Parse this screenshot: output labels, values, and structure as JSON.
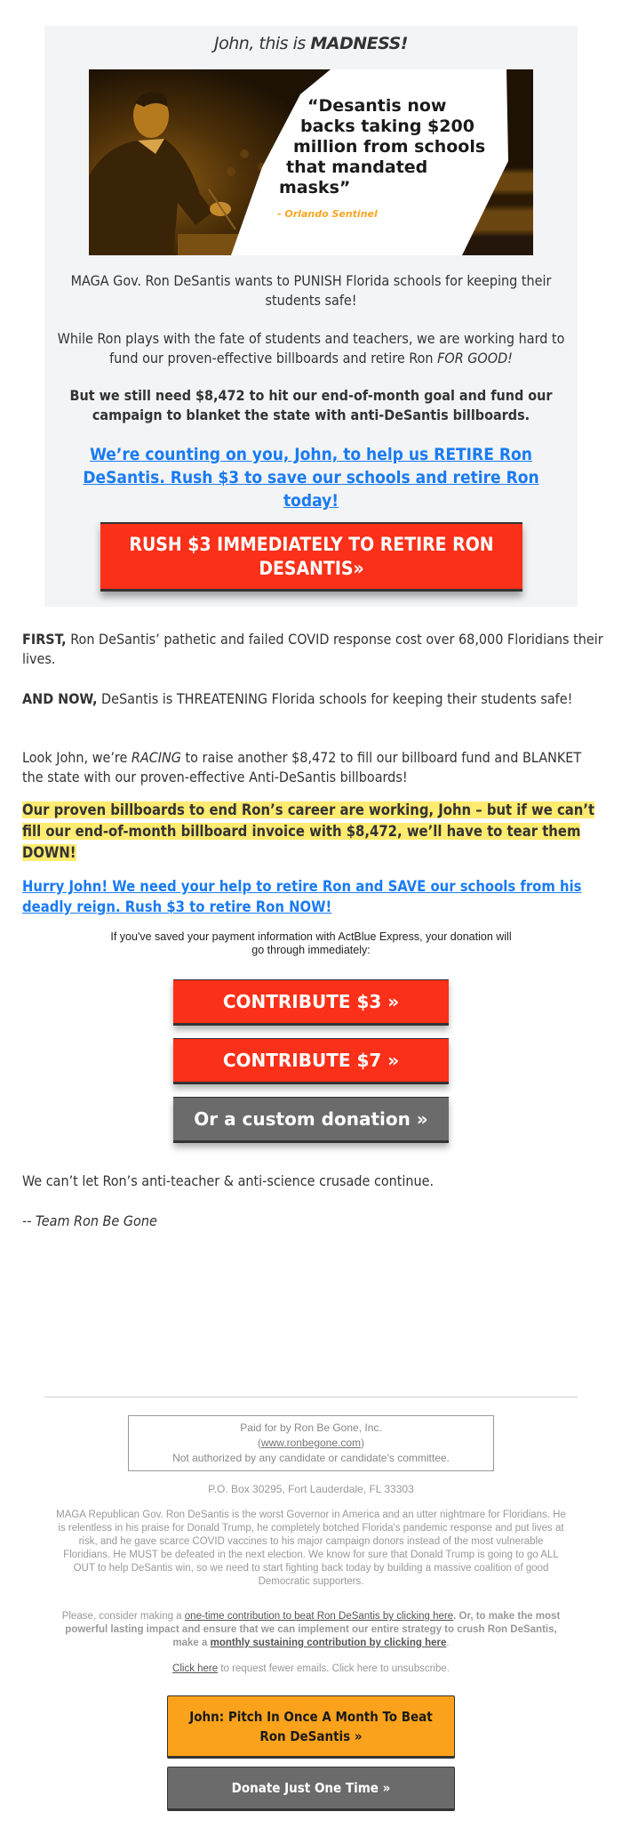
{
  "hero": {
    "title_prefix": "John, this is ",
    "title_emphasis": "MADNESS!",
    "image": {
      "quote_lines": [
        "“Desantis now",
        "backs taking $200",
        "million from schools",
        "that mandated",
        "masks”"
      ],
      "source": "- Orlando Sentinel"
    },
    "paragraph_1": "MAGA Gov. Ron DeSantis wants to PUNISH Florida schools for keeping their students safe!",
    "paragraph_2_main": "While Ron plays with the fate of students and teachers, we are working hard to fund our proven-effective billboards and retire Ron ",
    "paragraph_2_emphasis": "FOR GOOD!",
    "paragraph_3": "But we still need $8,472 to hit our end-of-month goal and fund our campaign to blanket the state with anti-DeSantis billboards.",
    "link_text": "We’re counting on you, John, to help us RETIRE Ron DeSantis. Rush $3 to save our schools and retire Ron today!",
    "button_label": "RUSH $3 IMMEDIATELY TO RETIRE RON DESANTIS»"
  },
  "body": {
    "first_lead": "FIRST,",
    "first_text": " Ron DeSantis’ pathetic and failed COVID response cost over 68,000 Floridians their lives.",
    "now_lead": "AND NOW,",
    "now_text": " DeSantis is THREATENING Florida schools for keeping their students safe!",
    "racing_prefix": "Look John, we’re ",
    "racing_emphasis": "RACING",
    "racing_suffix": " to raise another $8,472 to fill our billboard fund and BLANKET the state with our proven-effective Anti-DeSantis billboards!",
    "highlight_text": "Our proven billboards to end Ron’s career are working, John – but if we can’t fill our end-of-month billboard invoice with $8,472, we’ll have to tear them DOWN!",
    "hurry_link": "Hurry John! We need your help to retire Ron and SAVE our schools from his deadly reign. Rush $3 to retire Ron NOW!",
    "actblue_note": "If you've saved your payment information with ActBlue Express, your donation will go through immediately:",
    "donate_buttons": [
      {
        "label": "CONTRIBUTE $3 »",
        "color": "#fa3019"
      },
      {
        "label": "CONTRIBUTE $7 »",
        "color": "#fa3019"
      },
      {
        "label": "Or a custom donation »",
        "color": "#6b6b6b"
      }
    ],
    "closing": "We can’t let Ron’s anti-teacher & anti-science crusade continue.",
    "signature": "-- Team Ron Be Gone"
  },
  "footer": {
    "paid_for": "Paid for by Ron Be Gone, Inc.",
    "website_open": "(",
    "website": "www.ronbegone.com",
    "website_close": ")",
    "disclaimer": "Not authorized by any candidate or candidate's committee.",
    "address": "P.O. Box 30295, Fort Lauderdale, FL 33303",
    "about": "MAGA Republican Gov. Ron DeSantis is the worst Governor in America and an utter nightmare for Floridians. He is relentless in his praise for Donald Trump, he completely botched Florida's pandemic response and put lives at risk, and he gave scarce COVID vaccines to his major campaign donors instead of the most vulnerable Floridians. He MUST be defeated in the next election. We know for sure that Donald Trump is going to go ALL OUT to help DeSantis win, so we need to start fighting back today by building a massive coalition of good Democratic supporters.",
    "cta_prefix": "Please, consider making a ",
    "cta_onetime_link": "one-time contribution to beat Ron DeSantis by clicking here",
    "cta_middle": ". Or, to make the most powerful lasting impact and ensure that we can implement our entire strategy to crush Ron DeSantis, make a ",
    "cta_monthly_link": "monthly sustaining contribution by clicking here",
    "cta_end": ".",
    "unsub_link": "Click here",
    "unsub_text": " to request fewer emails. Click here to unsubscribe.",
    "monthly_button": "John: Pitch In Once A Month To Beat Ron DeSantis »",
    "onetime_button": "Donate Just One Time »"
  },
  "colors": {
    "accent_red": "#fa3019",
    "link_blue": "#1a7bf2",
    "highlight_yellow": "#ffeb70",
    "footer_orange": "#fba21c",
    "button_gray": "#6b6b6b",
    "hero_bg": "#f3f4f6"
  }
}
